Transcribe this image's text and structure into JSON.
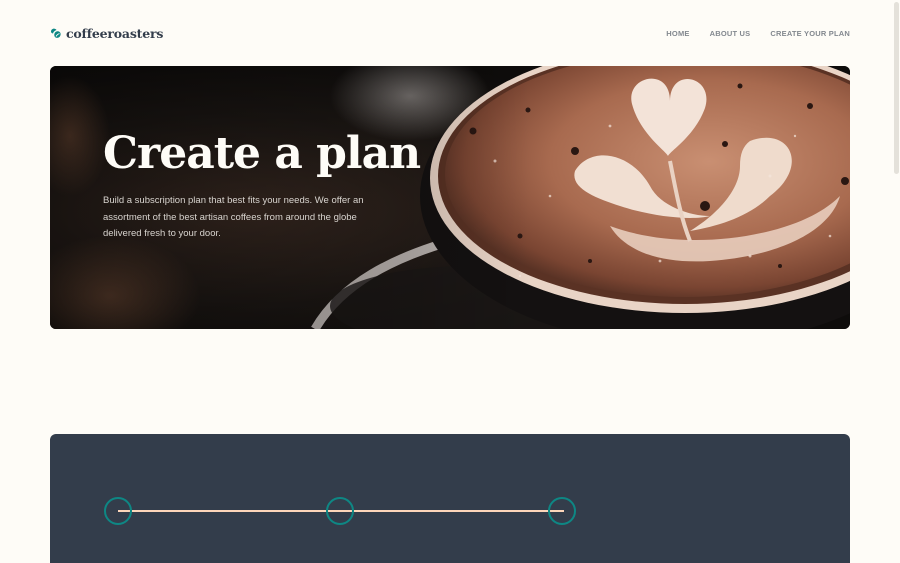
{
  "brand": {
    "name": "coffeeroasters",
    "accent": "#0E8784",
    "dark": "#333D4B",
    "cream": "#FEFCF7",
    "peach": "#FDD6BA"
  },
  "nav": {
    "items": [
      "HOME",
      "ABOUT US",
      "CREATE YOUR PLAN"
    ]
  },
  "hero": {
    "title": "Create a plan",
    "description": "Build a subscription plan that best fits your needs. We offer an assortment of the best artisan coffees from around the globe delivered fresh to your door."
  },
  "icons": {
    "logo": "coffee-bean-icon"
  }
}
